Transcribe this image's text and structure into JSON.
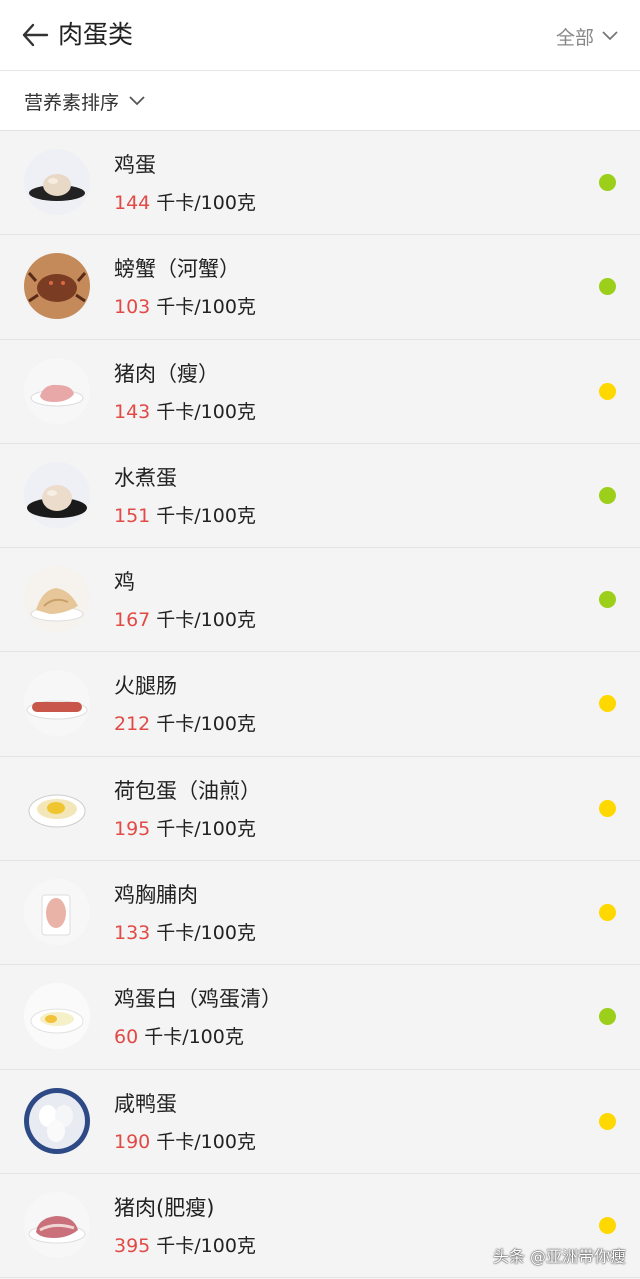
{
  "header": {
    "title": "肉蛋类",
    "filter_label": "全部"
  },
  "sort": {
    "label": "营养素排序"
  },
  "colors": {
    "green": "#9bcf19",
    "yellow": "#ffd800",
    "calorie_red": "#e14a46"
  },
  "calorie_unit": "千卡/100克",
  "items": [
    {
      "name": "鸡蛋",
      "calories": "144",
      "status": "green",
      "icon": "egg-on-plate"
    },
    {
      "name": "螃蟹（河蟹）",
      "calories": "103",
      "status": "green",
      "icon": "crab"
    },
    {
      "name": "猪肉（瘦）",
      "calories": "143",
      "status": "yellow",
      "icon": "lean-pork"
    },
    {
      "name": "水煮蛋",
      "calories": "151",
      "status": "green",
      "icon": "boiled-egg"
    },
    {
      "name": "鸡",
      "calories": "167",
      "status": "green",
      "icon": "chicken"
    },
    {
      "name": "火腿肠",
      "calories": "212",
      "status": "yellow",
      "icon": "ham-sausage"
    },
    {
      "name": "荷包蛋（油煎）",
      "calories": "195",
      "status": "yellow",
      "icon": "fried-egg"
    },
    {
      "name": "鸡胸脯肉",
      "calories": "133",
      "status": "yellow",
      "icon": "chicken-breast"
    },
    {
      "name": "鸡蛋白（鸡蛋清）",
      "calories": "60",
      "status": "green",
      "icon": "egg-white"
    },
    {
      "name": "咸鸭蛋",
      "calories": "190",
      "status": "yellow",
      "icon": "salted-duck-eggs"
    },
    {
      "name": "猪肉(肥瘦)",
      "calories": "395",
      "status": "yellow",
      "icon": "pork-fat-lean"
    }
  ],
  "watermark": "头条 @亚洲带你瘦"
}
